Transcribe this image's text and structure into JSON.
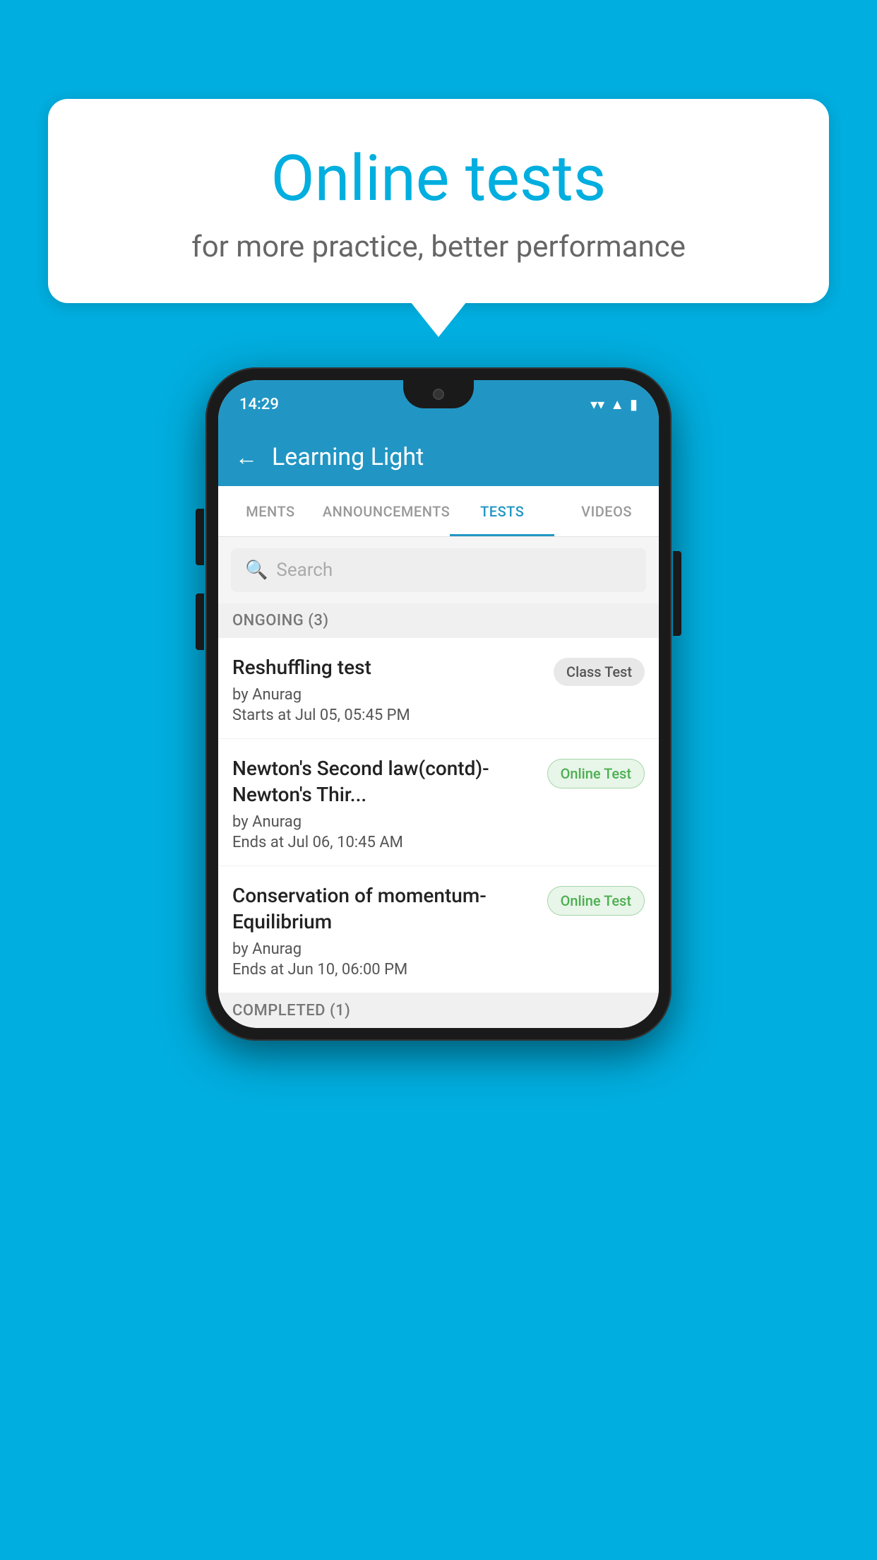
{
  "background_color": "#00AEDF",
  "bubble": {
    "title": "Online tests",
    "subtitle": "for more practice, better performance"
  },
  "phone": {
    "status_bar": {
      "time": "14:29",
      "icons": [
        "wifi",
        "signal",
        "battery"
      ]
    },
    "header": {
      "title": "Learning Light",
      "back_label": "←"
    },
    "tabs": [
      {
        "label": "MENTS",
        "active": false
      },
      {
        "label": "ANNOUNCEMENTS",
        "active": false
      },
      {
        "label": "TESTS",
        "active": true
      },
      {
        "label": "VIDEOS",
        "active": false
      }
    ],
    "search": {
      "placeholder": "Search"
    },
    "ongoing_section": {
      "label": "ONGOING (3)",
      "tests": [
        {
          "name": "Reshuffling test",
          "author": "by Anurag",
          "date": "Starts at  Jul 05, 05:45 PM",
          "badge": "Class Test",
          "badge_type": "class"
        },
        {
          "name": "Newton's Second law(contd)-Newton's Thir...",
          "author": "by Anurag",
          "date": "Ends at  Jul 06, 10:45 AM",
          "badge": "Online Test",
          "badge_type": "online"
        },
        {
          "name": "Conservation of momentum-Equilibrium",
          "author": "by Anurag",
          "date": "Ends at  Jun 10, 06:00 PM",
          "badge": "Online Test",
          "badge_type": "online"
        }
      ]
    },
    "completed_section": {
      "label": "COMPLETED (1)"
    }
  }
}
